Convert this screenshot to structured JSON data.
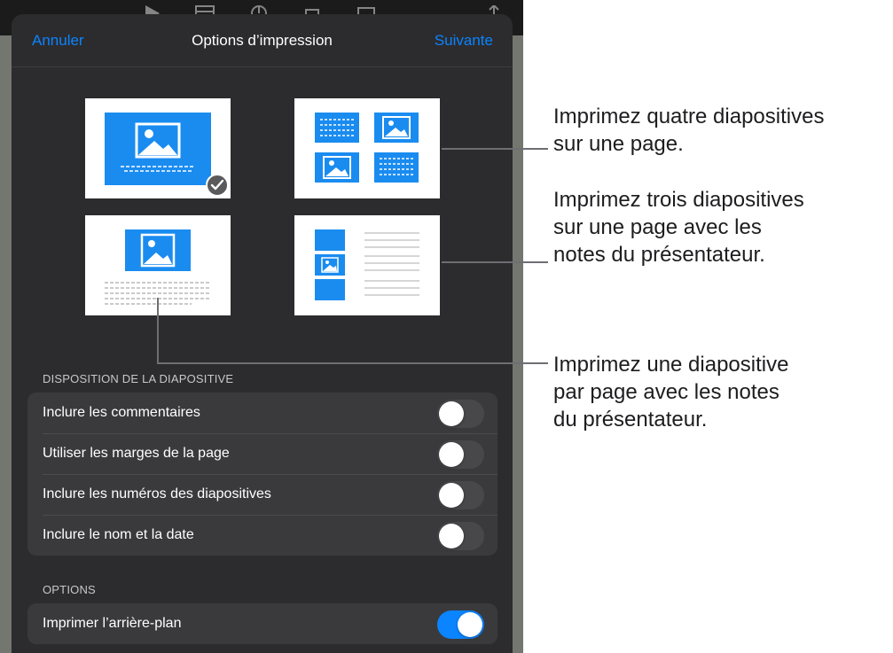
{
  "nav": {
    "cancel": "Annuler",
    "title": "Options d’impression",
    "next": "Suivante"
  },
  "layouts": [
    {
      "id": "one-slide",
      "selected": true
    },
    {
      "id": "four-slides",
      "selected": false
    },
    {
      "id": "one-slide-notes",
      "selected": false
    },
    {
      "id": "three-slides-notes",
      "selected": false
    }
  ],
  "slide_layout": {
    "header": "DISPOSITION DE LA DIAPOSITIVE",
    "rows": [
      {
        "label": "Inclure les commentaires",
        "on": false
      },
      {
        "label": "Utiliser les marges de la page",
        "on": false
      },
      {
        "label": "Inclure les numéros des diapositives",
        "on": false
      },
      {
        "label": "Inclure le nom et la date",
        "on": false
      }
    ]
  },
  "options": {
    "header": "OPTIONS",
    "rows": [
      {
        "label": "Imprimer l’arrière-plan",
        "on": true
      }
    ]
  },
  "callouts": [
    {
      "lines": [
        "Imprimez quatre diapositives",
        "sur une page."
      ]
    },
    {
      "lines": [
        "Imprimez trois diapositives",
        "sur une page avec les",
        "notes du présentateur."
      ]
    },
    {
      "lines": [
        "Imprimez une diapositive",
        "par page avec les notes",
        "du présentateur."
      ]
    }
  ],
  "colors": {
    "accent": "#0a84ff",
    "slide_blue": "#1a8cf0",
    "sheet": "#2c2c2e",
    "group": "#3a3a3c"
  }
}
